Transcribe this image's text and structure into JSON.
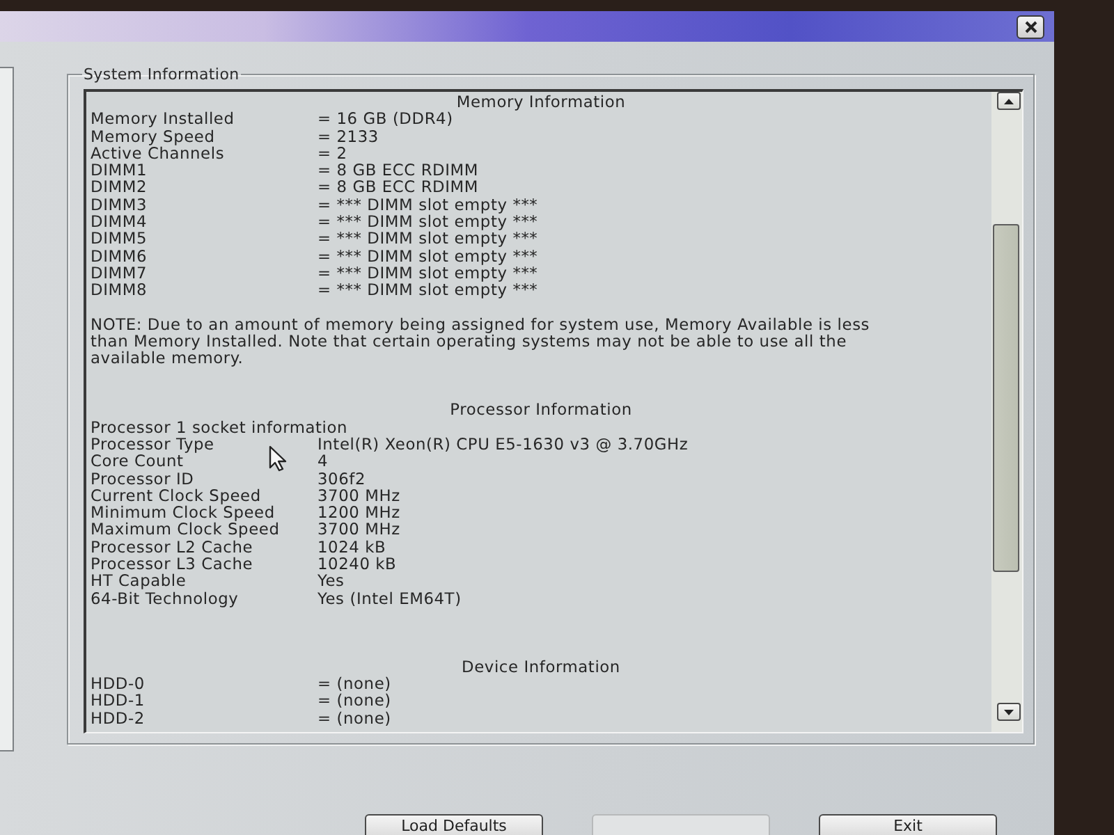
{
  "window": {
    "group_title": "System Information"
  },
  "memory": {
    "heading": "Memory Information",
    "rows": [
      {
        "label": "Memory Installed",
        "value": "= 16 GB (DDR4)"
      },
      {
        "label": "Memory Speed",
        "value": "= 2133"
      },
      {
        "label": "Active Channels",
        "value": "= 2"
      },
      {
        "label": "DIMM1",
        "value": "= 8 GB ECC RDIMM"
      },
      {
        "label": "DIMM2",
        "value": "= 8 GB ECC RDIMM"
      },
      {
        "label": "DIMM3",
        "value": "= *** DIMM slot empty ***"
      },
      {
        "label": "DIMM4",
        "value": "= *** DIMM slot empty ***"
      },
      {
        "label": "DIMM5",
        "value": "= *** DIMM slot empty ***"
      },
      {
        "label": "DIMM6",
        "value": "= *** DIMM slot empty ***"
      },
      {
        "label": "DIMM7",
        "value": "= *** DIMM slot empty ***"
      },
      {
        "label": "DIMM8",
        "value": "= *** DIMM slot empty ***"
      }
    ],
    "note": "NOTE: Due to an amount of memory being assigned for system use, Memory Available is less than Memory Installed. Note that certain operating systems may not be able to use all the available memory."
  },
  "processor": {
    "heading": "Processor Information",
    "socket": "Processor 1 socket information",
    "rows": [
      {
        "label": "Processor Type",
        "value": "Intel(R) Xeon(R) CPU E5-1630 v3 @ 3.70GHz"
      },
      {
        "label": "Core Count",
        "value": "4"
      },
      {
        "label": "Processor ID",
        "value": "306f2"
      },
      {
        "label": "Current Clock Speed",
        "value": "3700 MHz"
      },
      {
        "label": "Minimum Clock Speed",
        "value": "1200 MHz"
      },
      {
        "label": "Maximum Clock Speed",
        "value": "3700 MHz"
      },
      {
        "label": "Processor L2 Cache",
        "value": "1024 kB"
      },
      {
        "label": "Processor L3 Cache",
        "value": "10240 kB"
      },
      {
        "label": "HT Capable",
        "value": "Yes"
      },
      {
        "label": "64-Bit Technology",
        "value": "Yes (Intel EM64T)"
      }
    ]
  },
  "devices": {
    "heading": "Device Information",
    "rows": [
      {
        "label": "HDD-0",
        "value": "= (none)"
      },
      {
        "label": "HDD-1",
        "value": "= (none)"
      },
      {
        "label": "HDD-2",
        "value": "= (none)"
      }
    ]
  },
  "buttons": [
    {
      "label": "Load Defaults",
      "disabled": false
    },
    {
      "disabled": true
    },
    {
      "label": "Exit",
      "disabled": false
    }
  ]
}
